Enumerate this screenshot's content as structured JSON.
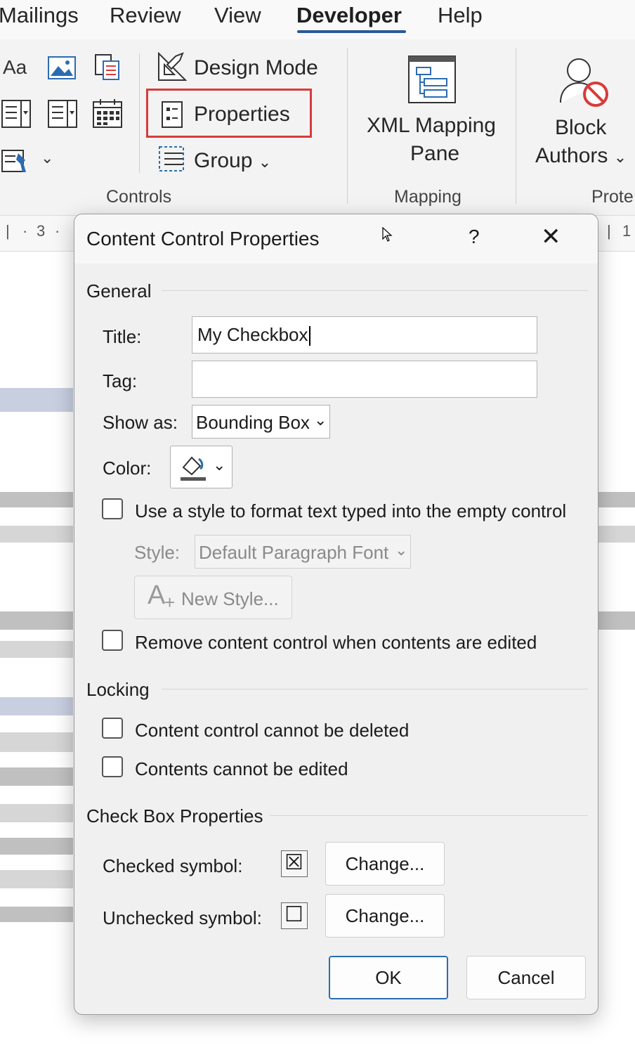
{
  "ribbon": {
    "tabs": [
      {
        "label": "Mailings",
        "active": false
      },
      {
        "label": "Review",
        "active": false
      },
      {
        "label": "View",
        "active": false
      },
      {
        "label": "Developer",
        "active": true
      },
      {
        "label": "Help",
        "active": false
      }
    ],
    "controls": {
      "design_mode": "Design Mode",
      "properties": "Properties",
      "group": "Group",
      "group_label": "Controls"
    },
    "mapping": {
      "xml_line1": "XML Mapping",
      "xml_line2": "Pane",
      "group_label": "Mapping"
    },
    "protect": {
      "block_line1": "Block",
      "block_line2": "Authors",
      "group_label": "Prote"
    },
    "accent": "#2b579a",
    "highlight": "#d83b3b"
  },
  "ruler": {
    "left_number": "3",
    "right_number": "1"
  },
  "dialog": {
    "title": "Content Control Properties",
    "help": "?",
    "close": "✕",
    "general": {
      "heading": "General",
      "title_label": "Title:",
      "title_value": "My Checkbox",
      "tag_label": "Tag:",
      "tag_value": "",
      "show_as_label": "Show as:",
      "show_as_value": "Bounding Box",
      "color_label": "Color:",
      "use_style_label": "Use a style to format text typed into the empty control",
      "style_label": "Style:",
      "style_value": "Default Paragraph Font",
      "new_style_label": "New Style...",
      "remove_label": "Remove content control when contents are edited"
    },
    "locking": {
      "heading": "Locking",
      "cannot_delete": "Content control cannot be deleted",
      "cannot_edit": "Contents cannot be edited"
    },
    "checkbox_props": {
      "heading": "Check Box Properties",
      "checked_label": "Checked symbol:",
      "checked_symbol": "☒",
      "unchecked_label": "Unchecked symbol:",
      "unchecked_symbol": "☐",
      "change_checked": "Change...",
      "change_unchecked": "Change..."
    },
    "ok": "OK",
    "cancel": "Cancel"
  }
}
